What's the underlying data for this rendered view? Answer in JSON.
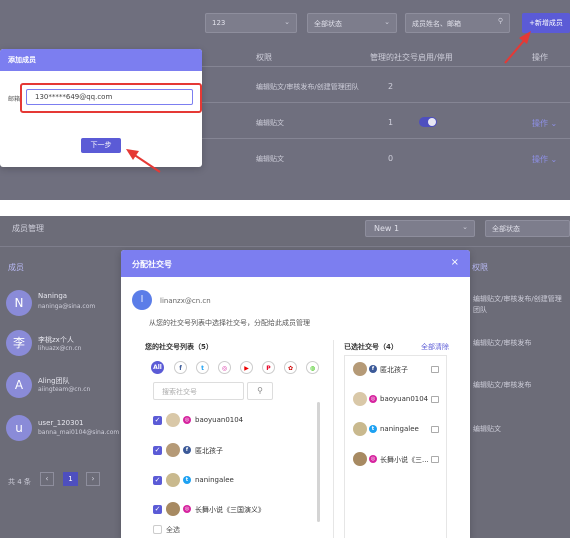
{
  "top": {
    "filter_value": "123",
    "status_select": "全部状态",
    "search_placeholder": "成员姓名、邮箱",
    "add_member_button": "+新增成员",
    "columns": {
      "permission": "权限",
      "managed_count": "管理的社交号",
      "enabled": "启用/停用",
      "ops": "操作"
    },
    "rows": [
      {
        "permission": "编辑贴文/审核发布/创建管理团队",
        "count": "2",
        "toggle": "",
        "ops": ""
      },
      {
        "permission": "编辑贴文",
        "count": "1",
        "toggle": "on",
        "ops": "操作"
      },
      {
        "permission": "编辑贴文",
        "count": "0",
        "toggle": "",
        "ops": "操作"
      }
    ],
    "modal": {
      "title": "添加成员",
      "email_label": "邮箱",
      "email_value": "130*****649@qq.com",
      "next_button": "下一步"
    }
  },
  "bottom": {
    "section_title": "成员管理",
    "new_select": "New 1",
    "status_select": "全部状态",
    "member_col": "成员",
    "permission_col": "权限",
    "members": [
      {
        "initial": "N",
        "name": "Naninga",
        "email": "naninga@sina.com"
      },
      {
        "initial": "李",
        "name": "李桃zx个人",
        "email": "lihuazx@cn.cn"
      },
      {
        "initial": "A",
        "name": "Aling团队",
        "email": "aiingteam@cn.cn"
      },
      {
        "initial": "u",
        "name": "user_120301",
        "email": "banna_mai0104@sina.com"
      }
    ],
    "permissions": [
      "编辑贴文/审核发布/创建管理团队",
      "编辑贴文/审核发布",
      "编辑贴文/审核发布",
      "编辑贴文"
    ],
    "pagination": {
      "total": "共 4 条",
      "page": "1"
    },
    "modal": {
      "title": "分配社交号",
      "close": "×",
      "user_initial": "l",
      "user_email": "linanzx@cn.cn",
      "instruction": "从您的社交号列表中选择社交号，分配给此成员管理",
      "list_title": "您的社交号列表（5）",
      "selected_title": "已选社交号（4）",
      "clear_all": "全部清除",
      "filter_all": "All",
      "search_placeholder": "搜索社交号",
      "accounts": [
        {
          "name": "baoyuan0104",
          "platform": "ig"
        },
        {
          "name": "匿北孩子",
          "platform": "fb"
        },
        {
          "name": "naningalee",
          "platform": "tw"
        },
        {
          "name": "长舞小说《三国演义》",
          "platform": "ig"
        }
      ],
      "selected": [
        {
          "name": "匿北孩子",
          "platform": "fb"
        },
        {
          "name": "baoyuan0104",
          "platform": "ig"
        },
        {
          "name": "naningalee",
          "platform": "tw"
        },
        {
          "name": "长舞小说《三...",
          "platform": "ig"
        }
      ],
      "select_all": "全选"
    }
  },
  "colors": {
    "accent": "#5b5bd6",
    "modal_header": "#7c7ef0",
    "highlight": "#e53935"
  }
}
